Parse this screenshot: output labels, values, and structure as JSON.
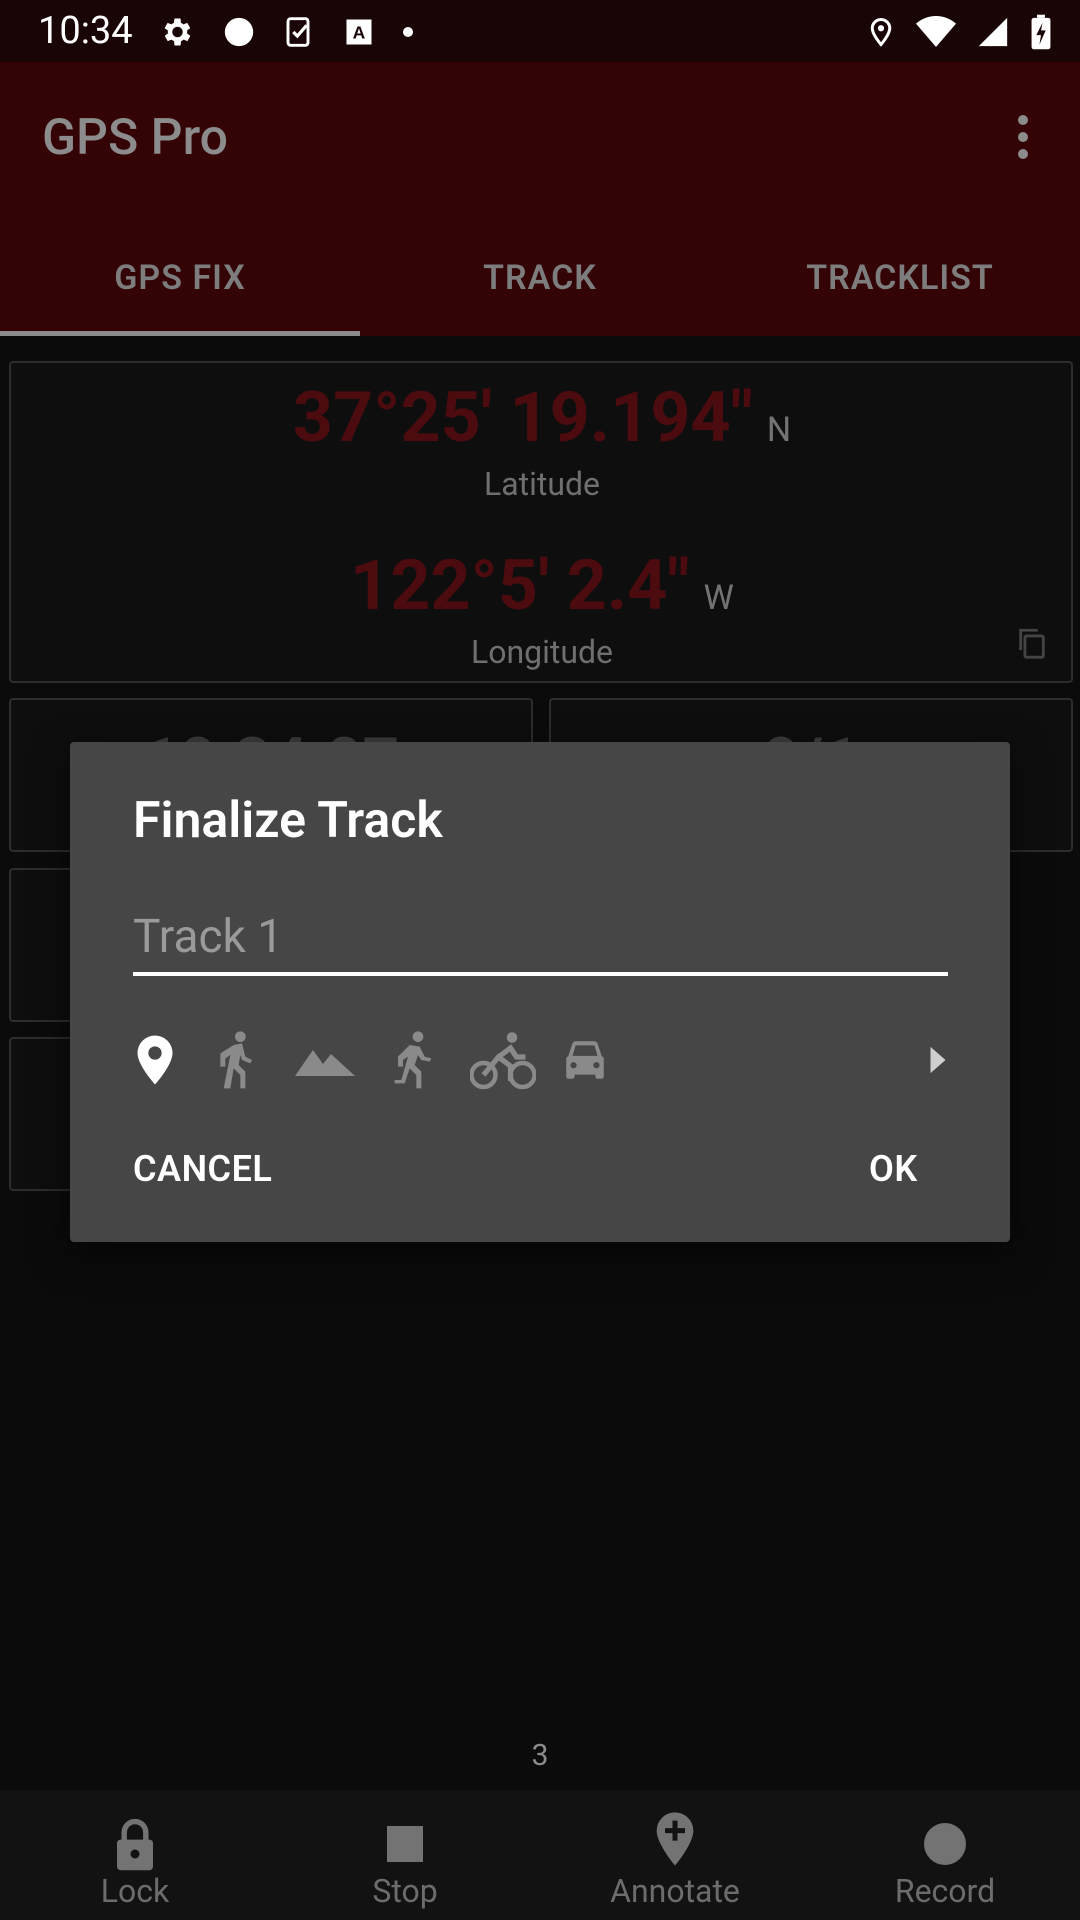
{
  "status_bar": {
    "time": "10:34",
    "left_icons": [
      "settings-icon",
      "circle-icon",
      "checklist-icon",
      "a-box-icon",
      "dot-icon"
    ],
    "right_icons": [
      "location-icon",
      "wifi-icon",
      "signal-icon",
      "battery-charging-icon"
    ]
  },
  "app_bar": {
    "title": "GPS Pro",
    "menu_icon": "overflow-menu-icon"
  },
  "tabs": [
    {
      "label": "GPS FIX",
      "active": true
    },
    {
      "label": "TRACK",
      "active": false
    },
    {
      "label": "TRACKLIST",
      "active": false
    }
  ],
  "gps_fix": {
    "latitude_value": "37°25' 19.194\"",
    "latitude_dir": "N",
    "latitude_label": "Latitude",
    "longitude_value": "122°5' 2.4\"",
    "longitude_dir": "W",
    "longitude_label": "Longitude",
    "time_partial": "10:34:07",
    "sats_partial": "0/1"
  },
  "dialog": {
    "title": "Finalize Track",
    "track_name_placeholder": "Track 1",
    "activity_icons": [
      "location-pin-icon",
      "walk-icon",
      "mountain-icon",
      "run-icon",
      "bike-icon",
      "car-icon"
    ],
    "more_icon": "arrow-right-icon",
    "cancel_label": "CANCEL",
    "ok_label": "OK"
  },
  "page_indicator": "3",
  "bottom_nav": [
    {
      "label": "Lock",
      "icon": "lock-icon"
    },
    {
      "label": "Stop",
      "icon": "stop-icon"
    },
    {
      "label": "Annotate",
      "icon": "add-location-icon"
    },
    {
      "label": "Record",
      "icon": "record-icon"
    }
  ],
  "colors": {
    "app_bar": "#330306",
    "status_bar": "#1a0506",
    "dialog_bg": "#464646",
    "coord_red": "#4c0b0e"
  }
}
